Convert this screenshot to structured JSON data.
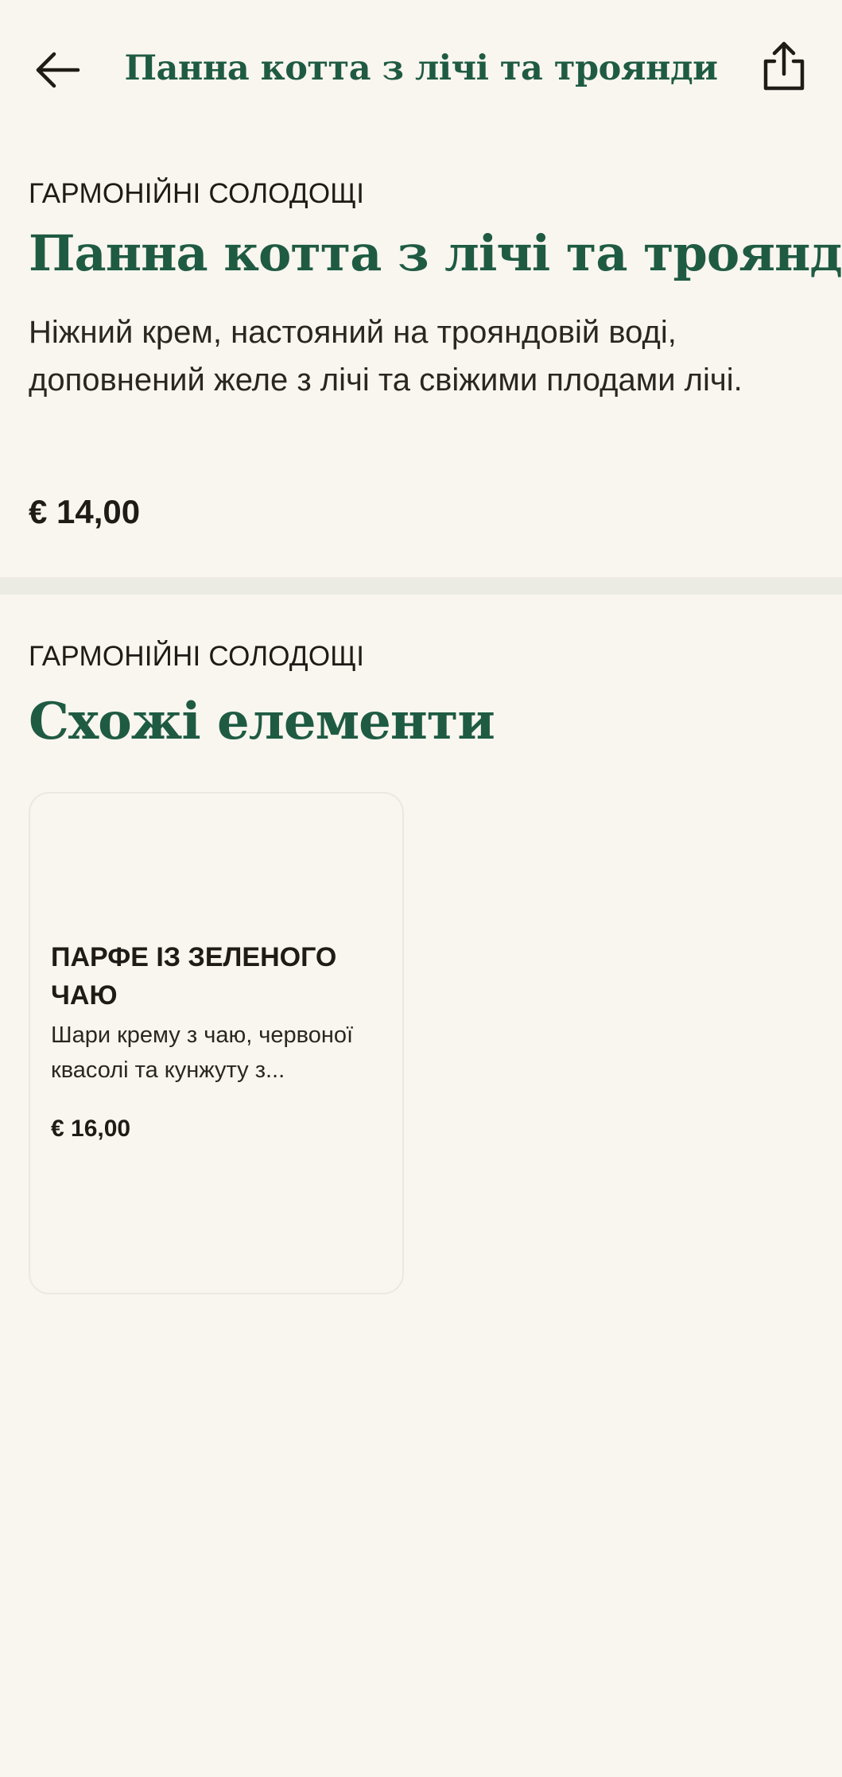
{
  "header": {
    "title": "Панна котта з лічі та троянди",
    "back_icon": "arrow-left-icon",
    "share_icon": "share-icon"
  },
  "item": {
    "category": "ГАРМОНІЙНІ СОЛОДОЩІ",
    "title": "Панна котта з лічі та троянди",
    "description": "Ніжний крем, настояний на трояндовій воді, доповнений желе з лічі та свіжими плодами лічі.",
    "price": "€ 14,00"
  },
  "related": {
    "category": "ГАРМОНІЙНІ СОЛОДОЩІ",
    "title": "Схожі елементи",
    "items": [
      {
        "title": "ПАРФЕ ІЗ ЗЕЛЕНОГО ЧАЮ",
        "description": "Шари крему з чаю, червоної квасолі та кунжуту з...",
        "price": "€ 16,00"
      }
    ]
  },
  "colors": {
    "background": "#f9f6ef",
    "accent": "#1f5b43",
    "text": "#1f1c17",
    "divider": "#ecebe3"
  }
}
